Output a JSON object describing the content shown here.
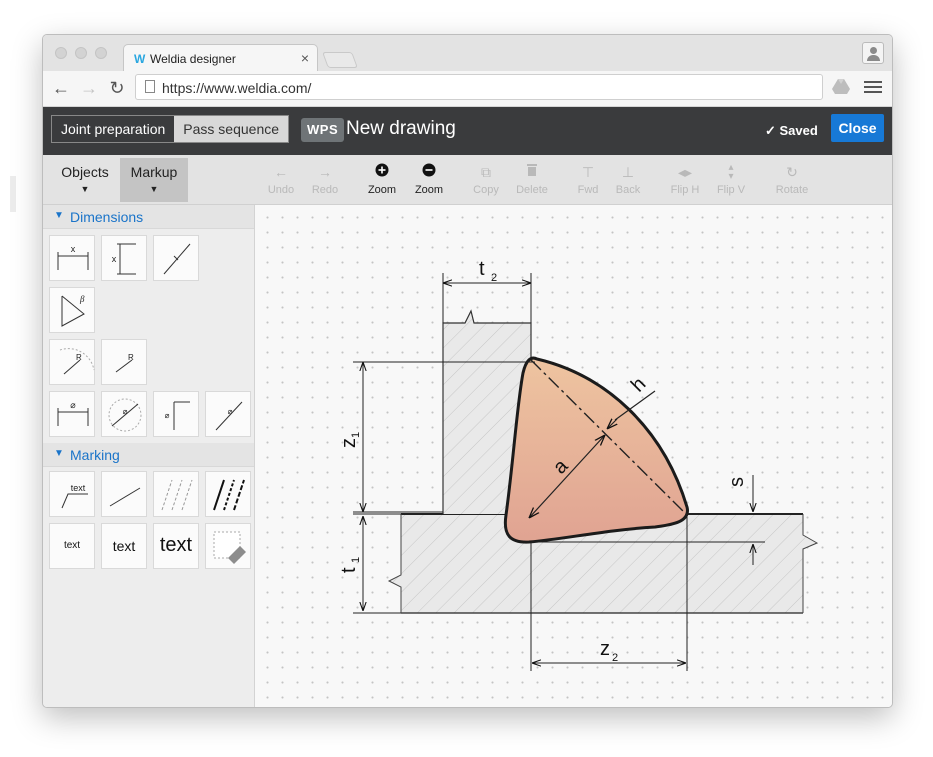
{
  "browser": {
    "tab_title": "Weldia designer",
    "tab_logo": "W",
    "url": "https://www.weldia.com/"
  },
  "header": {
    "mode_joint": "Joint preparation",
    "mode_pass": "Pass sequence",
    "badge": "WPS",
    "title": "New drawing",
    "saved": "✓ Saved",
    "close": "Close"
  },
  "toolbar": {
    "objects": "Objects",
    "markup": "Markup",
    "undo": "Undo",
    "redo": "Redo",
    "zoom_in": "Zoom",
    "zoom_out": "Zoom",
    "copy": "Copy",
    "delete": "Delete",
    "fwd": "Fwd",
    "back": "Back",
    "flip_h": "Flip H",
    "flip_v": "Flip V",
    "rotate": "Rotate"
  },
  "palette": {
    "dimensions": "Dimensions",
    "marking": "Marking",
    "dim_x": "x",
    "dim_beta": "β",
    "dim_r": "R",
    "dim_dia": "⌀",
    "mark_text_leader": "text",
    "mark_text_small": "text",
    "mark_text_medium": "text",
    "mark_text_large": "text"
  },
  "drawing": {
    "t2": "t",
    "t2_sub": "2",
    "z1": "z",
    "z1_sub": "1",
    "t1": "t",
    "t1_sub": "1",
    "z2": "z",
    "z2_sub": "2",
    "a": "a",
    "h": "h",
    "s": "s",
    "weld_fill_top": "#eec4a0",
    "weld_fill_bottom": "#e0a392"
  }
}
